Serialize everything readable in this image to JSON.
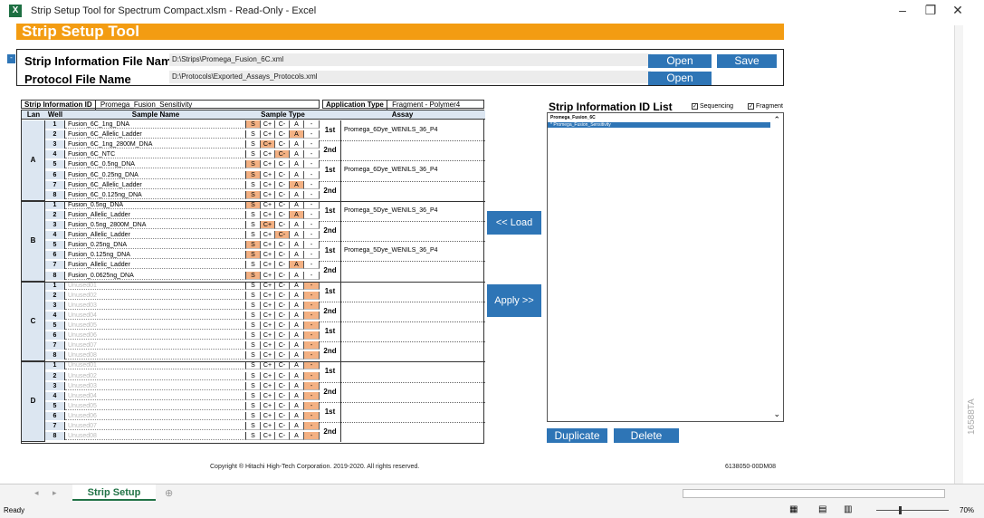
{
  "window": {
    "title": "Strip Setup Tool for Spectrum Compact.xlsm  -  Read-Only  -  Excel",
    "app_icon": "X"
  },
  "banner": {
    "title": "Strip Setup Tool"
  },
  "files": {
    "strip_label": "Strip Information File Name",
    "strip_path": "D:\\Strips\\Promega_Fusion_6C.xml",
    "protocol_label": "Protocol File Name",
    "protocol_path": "D:\\Protocols\\Exported_Assays_Protocols.xml",
    "open1": "Open",
    "save": "Save",
    "open2": "Open"
  },
  "side_marker": "-",
  "info": {
    "id_label": "Strip Information ID",
    "id_value": "Promega_Fusion_Sensitivity",
    "app_label": "Application Type",
    "app_value": "Fragment - Polymer4"
  },
  "grid_headers": {
    "lane": "Lan",
    "well": "Well",
    "sample": "Sample Name",
    "type": "Sample Type",
    "assay": "Assay"
  },
  "type_labels": [
    "S",
    "C+",
    "C-",
    "A",
    "-"
  ],
  "lanes": [
    "A",
    "B",
    "C",
    "D"
  ],
  "pass_labels": {
    "first": "1st",
    "second": "2nd"
  },
  "rows": [
    {
      "well": "1",
      "name": "Fusion_6C_1ng_DNA",
      "t": 0
    },
    {
      "well": "2",
      "name": "Fusion_6C_Allelic_Ladder",
      "t": 3
    },
    {
      "well": "3",
      "name": "Fusion_6C_1ng_2800M_DNA",
      "t": 1
    },
    {
      "well": "4",
      "name": "Fusion_6C_NTC",
      "t": 2
    },
    {
      "well": "5",
      "name": "Fusion_6C_0.5ng_DNA",
      "t": 0
    },
    {
      "well": "6",
      "name": "Fusion_6C_0.25ng_DNA",
      "t": 0
    },
    {
      "well": "7",
      "name": "Fusion_6C_Allelic_Ladder",
      "t": 3
    },
    {
      "well": "8",
      "name": "Fusion_6C_0.125ng_DNA",
      "t": 0
    },
    {
      "well": "1",
      "name": "Fusion_0.5ng_DNA",
      "t": 0
    },
    {
      "well": "2",
      "name": "Fusion_Allelic_Ladder",
      "t": 3
    },
    {
      "well": "3",
      "name": "Fusion_0.5ng_2800M_DNA",
      "t": 1
    },
    {
      "well": "4",
      "name": "Fusion_Allelic_Ladder",
      "t": 2
    },
    {
      "well": "5",
      "name": "Fusion_0.25ng_DNA",
      "t": 0
    },
    {
      "well": "6",
      "name": "Fusion_0.125ng_DNA",
      "t": 0
    },
    {
      "well": "7",
      "name": "Fusion_Allelic_Ladder",
      "t": 3
    },
    {
      "well": "8",
      "name": "Fusion_0.0625ng_DNA",
      "t": 0
    },
    {
      "well": "1",
      "name": "Unused01",
      "t": 4
    },
    {
      "well": "2",
      "name": "Unused02",
      "t": 4
    },
    {
      "well": "3",
      "name": "Unused03",
      "t": 4
    },
    {
      "well": "4",
      "name": "Unused04",
      "t": 4
    },
    {
      "well": "5",
      "name": "Unused05",
      "t": 4
    },
    {
      "well": "6",
      "name": "Unused06",
      "t": 4
    },
    {
      "well": "7",
      "name": "Unused07",
      "t": 4
    },
    {
      "well": "8",
      "name": "Unused08",
      "t": 4
    },
    {
      "well": "1",
      "name": "Unused01",
      "t": 4
    },
    {
      "well": "2",
      "name": "Unused02",
      "t": 4
    },
    {
      "well": "3",
      "name": "Unused03",
      "t": 4
    },
    {
      "well": "4",
      "name": "Unused04",
      "t": 4
    },
    {
      "well": "5",
      "name": "Unused05",
      "t": 4
    },
    {
      "well": "6",
      "name": "Unused06",
      "t": 4
    },
    {
      "well": "7",
      "name": "Unused07",
      "t": 4
    },
    {
      "well": "8",
      "name": "Unused08",
      "t": 4
    }
  ],
  "assays": [
    "Promega_6Dye_WENILS_36_P4",
    "",
    "Promega_6Dye_WENILS_36_P4",
    "",
    "Promega_5Dye_WENILS_36_P4",
    "",
    "Promega_5Dye_WENILS_36_P4",
    "",
    "",
    "",
    "",
    "",
    "",
    "",
    "",
    ""
  ],
  "mid_buttons": {
    "load": "<< Load",
    "apply": "Apply >>"
  },
  "list": {
    "title": "Strip Information ID List",
    "seq_label": "Sequencing",
    "frag_label": "Fragment",
    "items": [
      "Promega_Fusion_6C",
      "* Promega_Fusion_Sensitivity"
    ],
    "duplicate": "Duplicate",
    "delete": "Delete"
  },
  "footer": {
    "copyright": "Copyright ® Hitachi High-Tech Corporation. 2019-2020. All rights reserved.",
    "code": "6138050-00DM08"
  },
  "sheet_tab": "Strip Setup",
  "status": {
    "ready": "Ready",
    "zoom": "70%"
  },
  "side_code": "16588TA",
  "colors": {
    "accent": "#f39c12",
    "button": "#2e75b6",
    "selected": "#f4b183"
  }
}
